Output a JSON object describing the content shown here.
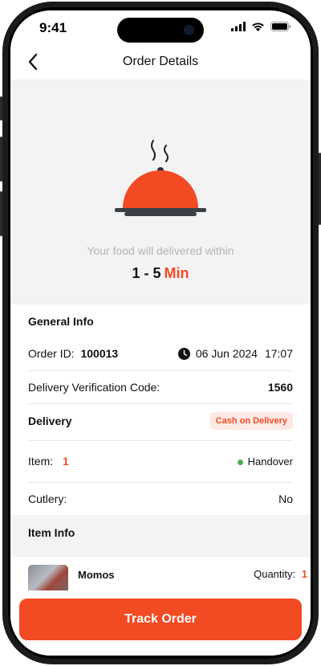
{
  "status_bar": {
    "time": "9:41"
  },
  "header": {
    "title": "Order Details"
  },
  "hero": {
    "message": "Your food will delivered within",
    "eta_value": "1 - 5",
    "eta_unit": "Min"
  },
  "general_info": {
    "title": "General Info",
    "order_id_label": "Order ID:",
    "order_id": "100013",
    "date": "06 Jun 2024",
    "time": "17:07",
    "verification_label": "Delivery Verification Code:",
    "verification_code": "1560",
    "delivery_label": "Delivery",
    "payment_badge": "Cash on Delivery",
    "item_label": "Item:",
    "item_count": "1",
    "status": "Handover",
    "cutlery_label": "Cutlery:",
    "cutlery_value": "No"
  },
  "item_info": {
    "title": "Item Info",
    "items": [
      {
        "name": "Momos",
        "quantity_label": "Quantity:",
        "quantity": "1"
      }
    ]
  },
  "actions": {
    "track_order": "Track Order"
  },
  "colors": {
    "accent": "#f24a22",
    "hero_bg": "#f3f3f3",
    "status_dot": "#4caf50",
    "badge_bg": "#fde9e4"
  },
  "icons": [
    "back-arrow-icon",
    "clock-icon",
    "cellular-signal-icon",
    "wifi-icon",
    "battery-icon",
    "food-cloche-icon"
  ]
}
